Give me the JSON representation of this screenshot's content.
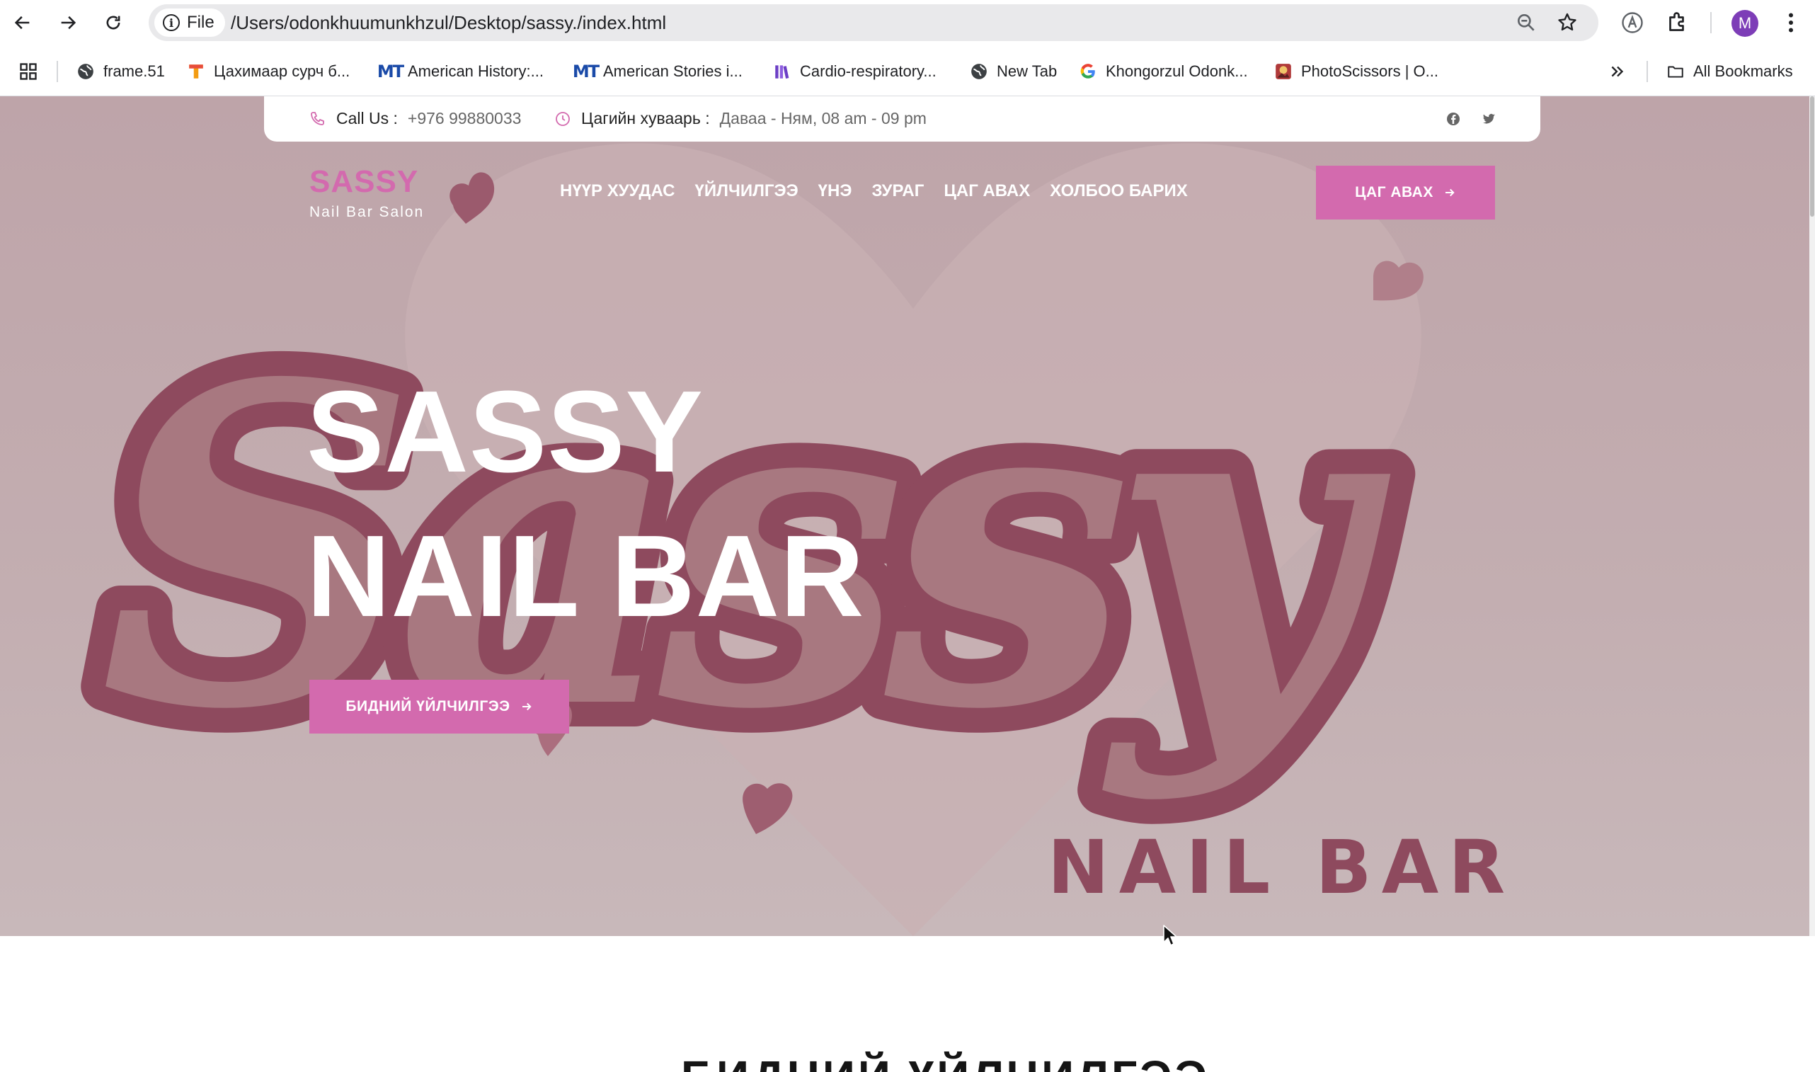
{
  "browser": {
    "url_chip": "File",
    "url": "/Users/odonkhuumunkhzul/Desktop/sassy./index.html",
    "profile_initial": "M",
    "bookmarks": [
      {
        "label": "frame.51",
        "icon": "globe-icon"
      },
      {
        "label": "Цахимаар сурч б...",
        "icon": "tahimaar-favicon"
      },
      {
        "label": "American History:...",
        "icon": "mt-favicon"
      },
      {
        "label": "American Stories i...",
        "icon": "mt-favicon"
      },
      {
        "label": "Cardio-respiratory...",
        "icon": "books-favicon"
      },
      {
        "label": "New Tab",
        "icon": "globe-icon"
      },
      {
        "label": "Khongorzul Odonk...",
        "icon": "google-icon"
      },
      {
        "label": "PhotoScissors | O...",
        "icon": "photoscissors-favicon"
      }
    ],
    "all_bookmarks": "All Bookmarks"
  },
  "topbar": {
    "call_label": "Call Us :",
    "phone": "+976 99880033",
    "hours_label": "Цагийн хуваарь :",
    "hours": "Даваа - Ням, 08 am - 09 pm"
  },
  "logo": {
    "title": "SASSY",
    "subtitle": "Nail Bar Salon"
  },
  "nav": [
    "НҮҮР ХУУДАС",
    "ҮЙЛЧИЛГЭЭ",
    "ҮНЭ",
    "ЗУРАГ",
    "ЦАГ АВАХ",
    "ХОЛБОО БАРИХ"
  ],
  "cta_label": "ЦАГ АВАХ",
  "hero": {
    "line1": "SASSY",
    "line2": "NAIL BAR",
    "button": "БИДНИЙ ҮЙЛЧИЛГЭЭ",
    "art_script": "Sassy",
    "art_caption": "NAIL BAR"
  },
  "next_section_title": "БИДНИЙ ҮЙЛЧИЛГЭЭ",
  "colors": {
    "brand_pink": "#d36aae",
    "hero_bg": "#bea4a9",
    "script_dark": "#8e4a5e",
    "script_fill": "#a87880"
  }
}
